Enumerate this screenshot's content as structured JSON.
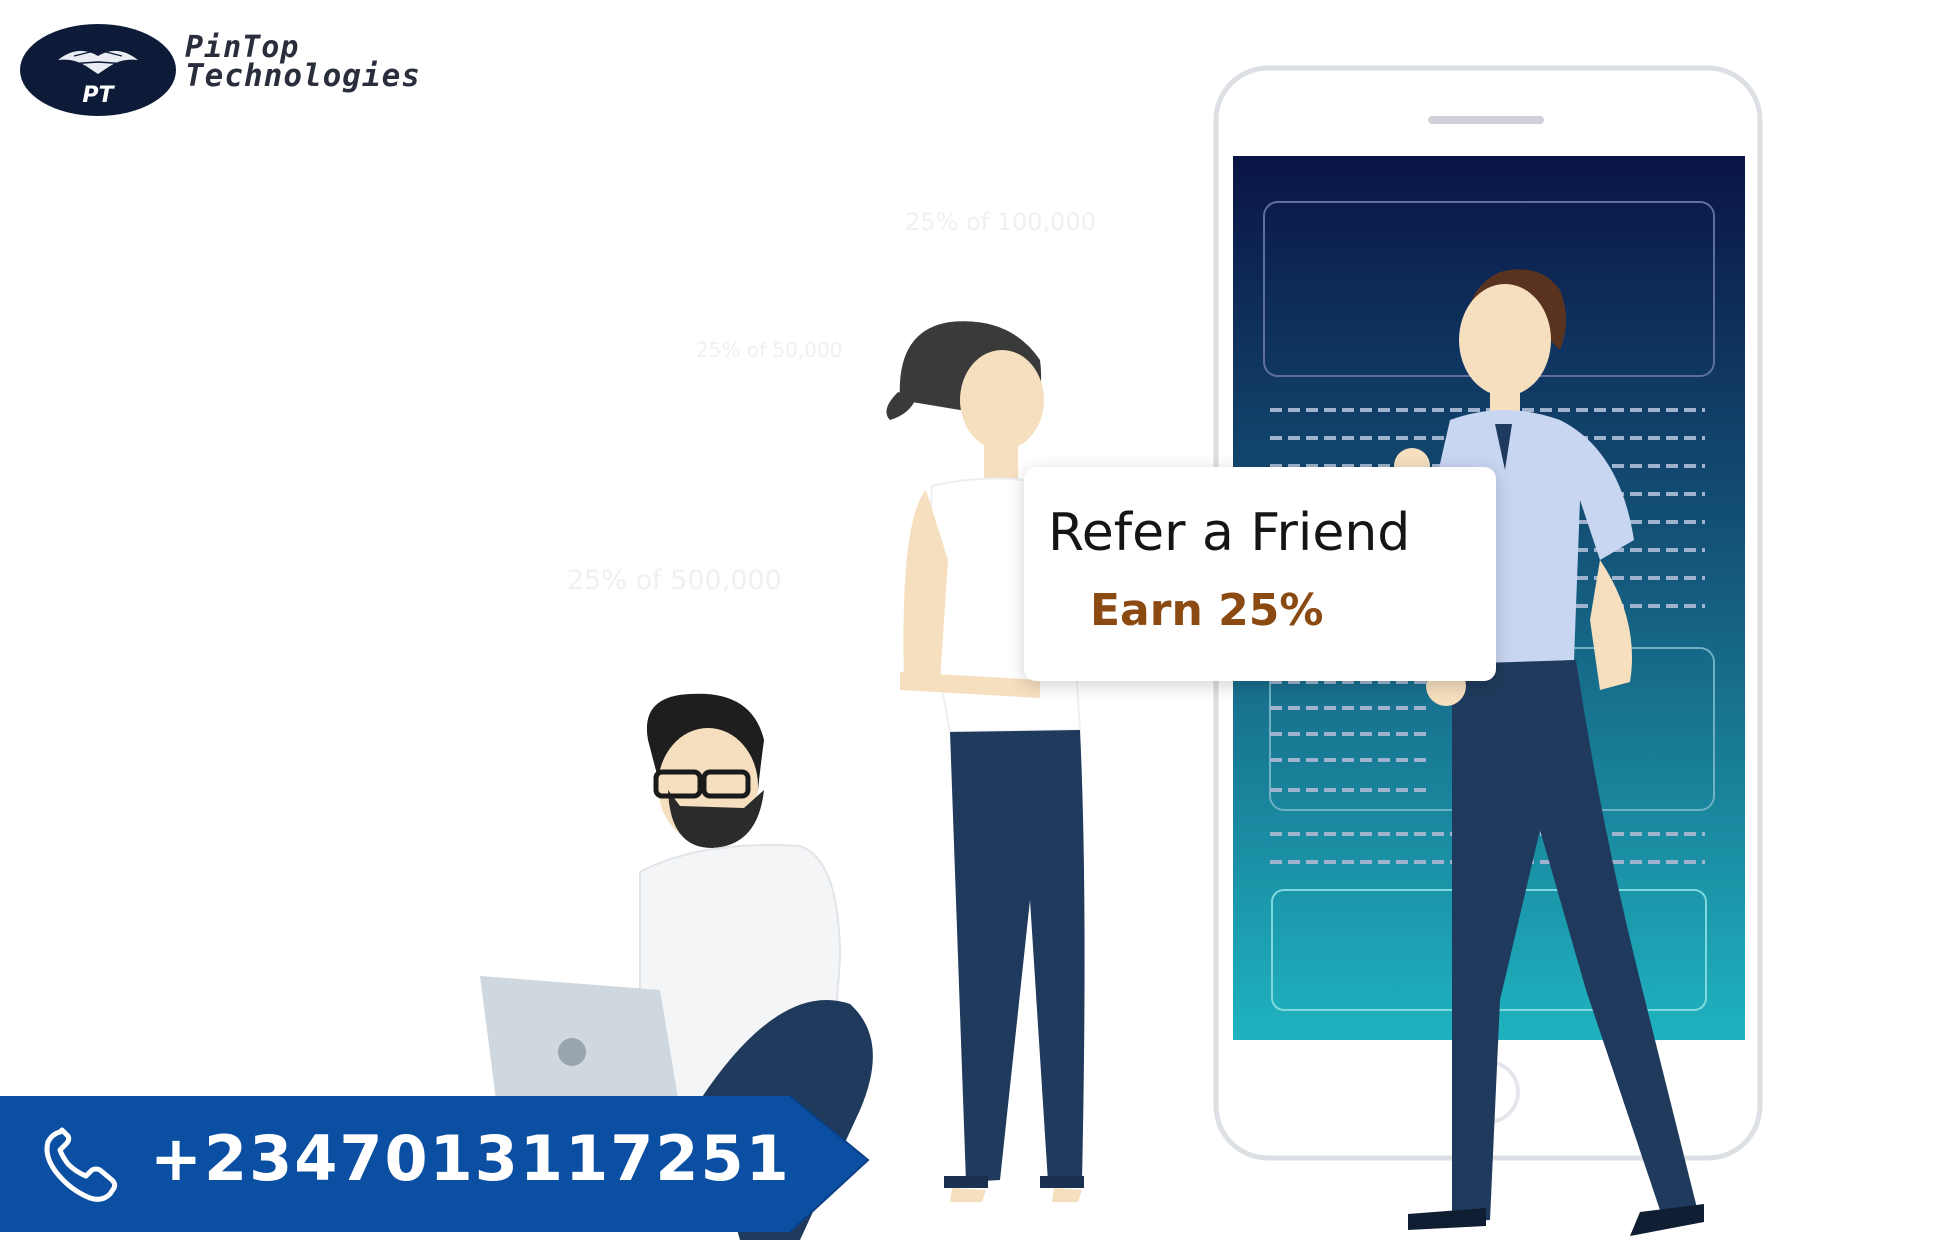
{
  "brand": {
    "name_line1": "PinTop",
    "name_line2": "Technologies",
    "badge_initials": "PT"
  },
  "watermarks": {
    "w1": "25% of 100,000",
    "w2": "25% of 50,000",
    "w3": "25% of 500,000"
  },
  "promo": {
    "title": "Refer a Friend",
    "subtitle": "Earn 25%"
  },
  "contact": {
    "phone": "+2347013117251",
    "icon": "phone-icon"
  },
  "colors": {
    "banner_blue": "#0b4fa3",
    "earn_brown": "#8a4a12",
    "screen_top": "#0a1445",
    "screen_bottom": "#1fb3bf",
    "logo_dark": "#0d1a38"
  }
}
